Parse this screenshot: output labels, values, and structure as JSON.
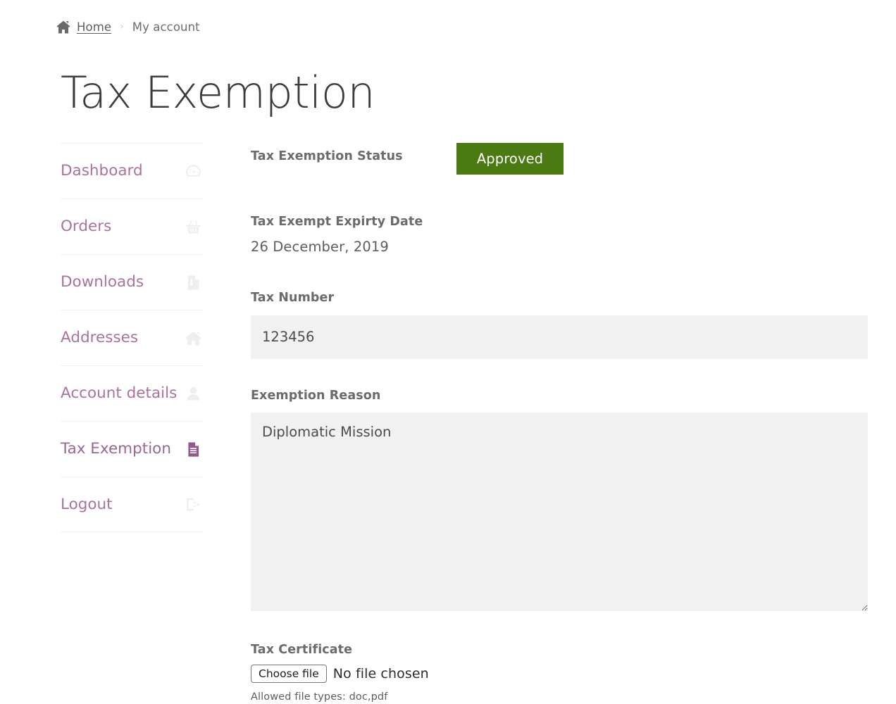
{
  "breadcrumb": {
    "home_icon": "home-icon",
    "home_label": "Home",
    "separator": "›",
    "current_label": "My account"
  },
  "page": {
    "title": "Tax Exemption"
  },
  "sidebar": {
    "items": [
      {
        "label": "Dashboard",
        "icon": "speedometer-icon",
        "active": false
      },
      {
        "label": "Orders",
        "icon": "basket-icon",
        "active": false
      },
      {
        "label": "Downloads",
        "icon": "download-file-icon",
        "active": false
      },
      {
        "label": "Addresses",
        "icon": "house-icon",
        "active": false
      },
      {
        "label": "Account details",
        "icon": "person-icon",
        "active": false
      },
      {
        "label": "Tax Exemption",
        "icon": "document-icon",
        "active": true
      },
      {
        "label": "Logout",
        "icon": "sign-out-icon",
        "active": false
      }
    ]
  },
  "form": {
    "status_label": "Tax Exemption Status",
    "status_value": "Approved",
    "status_color": "#4c7a12",
    "expiry_label": "Tax Exempt Expirty Date",
    "expiry_value": "26 December, 2019",
    "tax_number_label": "Tax Number",
    "tax_number_value": "123456",
    "tax_number_placeholder": "",
    "reason_label": "Exemption Reason",
    "reason_value": "Diplomatic Mission",
    "reason_placeholder": "",
    "certificate_label": "Tax Certificate",
    "file_button_label": "Choose file",
    "file_status_text": "No file chosen",
    "allowed_types_text": "Allowed file types: doc,pdf"
  },
  "theme": {
    "link_purple": "#a9739f",
    "active_purple": "#8e5d89",
    "approved_green": "#4c7a12",
    "field_bg": "#f1f1f1"
  }
}
